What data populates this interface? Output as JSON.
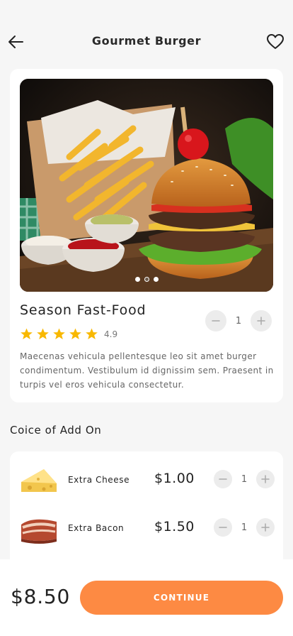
{
  "header": {
    "title": "Gourmet Burger",
    "back_icon": "arrow-left-icon",
    "favorite_icon": "heart-icon"
  },
  "product": {
    "name": "Season Fast-Food",
    "rating": "4.9",
    "stars": 5,
    "quantity": "1",
    "description": "Maecenas vehicula pellentesque leo sit amet burger condimentum. Vestibulum id dignissim sem. Praesent in turpis vel eros vehicula consectetur.",
    "carousel_active_index": 2,
    "carousel_count": 3
  },
  "addons": {
    "heading": "Coice of Add On",
    "items": [
      {
        "name": "Extra Cheese",
        "price": "$1.00",
        "quantity": "1"
      },
      {
        "name": "Extra Bacon",
        "price": "$1.50",
        "quantity": "1"
      }
    ]
  },
  "footer": {
    "total": "$8.50",
    "continue_label": "CONTINUE"
  },
  "colors": {
    "accent": "#fd8a43",
    "star": "#f8b800",
    "background": "#f6f6f6"
  }
}
